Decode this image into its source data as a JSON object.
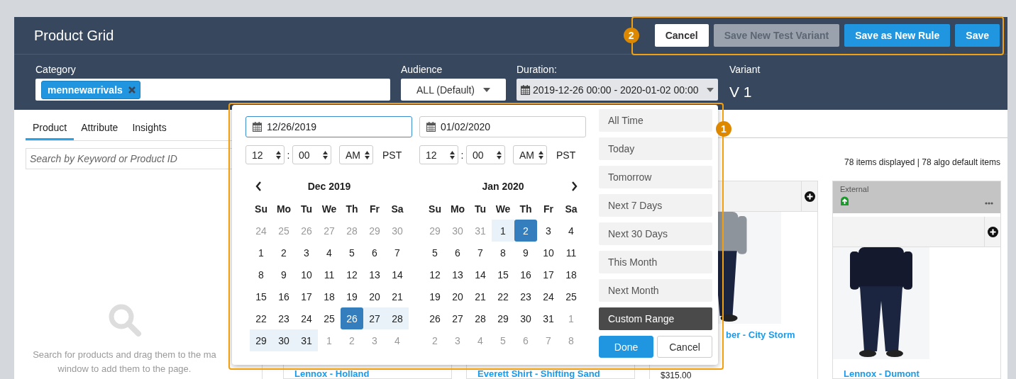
{
  "window": {
    "title": "Product Grid"
  },
  "header_buttons": [
    {
      "label": "Cancel",
      "kind": "default",
      "disabled": false
    },
    {
      "label": "Save New Test Variant",
      "kind": "default",
      "disabled": true
    },
    {
      "label": "Save as New Rule",
      "kind": "primary",
      "disabled": false
    },
    {
      "label": "Save",
      "kind": "primary",
      "disabled": false
    }
  ],
  "filters": {
    "category": {
      "label": "Category",
      "chips": [
        "mennewarrivals"
      ]
    },
    "audience": {
      "label": "Audience",
      "value": "ALL (Default)"
    },
    "duration": {
      "label": "Duration:",
      "value": "2019-12-26 00:00 - 2020-01-02 00:00"
    },
    "variant": {
      "label": "Variant",
      "value": "V 1"
    }
  },
  "left_panel": {
    "tabs": [
      {
        "label": "Product",
        "selected": true
      },
      {
        "label": "Attribute",
        "selected": false
      },
      {
        "label": "Insights",
        "selected": false
      }
    ],
    "search": {
      "placeholder": "Search by Keyword or Product ID"
    },
    "empty_text_lines": [
      "Search for products and drag them to the ma",
      "window to add them to the page."
    ]
  },
  "grid": {
    "count_text": "78 items displayed | 78 algo default items",
    "cards": [
      {
        "kind": "external",
        "name": "Lennox - Holland"
      },
      {
        "kind": "external",
        "name": "Everett Shirt - Shifting Sand"
      },
      {
        "kind": "plain",
        "name": "ber - City Storm",
        "price": "$315.00"
      },
      {
        "kind": "external",
        "tag": "External",
        "name": "Lennox - Dumont"
      }
    ]
  },
  "date_picker": {
    "inputs": [
      {
        "value": "12/26/2019",
        "focused": true
      },
      {
        "value": "01/02/2020",
        "focused": false
      }
    ],
    "times": [
      {
        "hour": "12",
        "separator": ":",
        "minute": "00",
        "ampm": "AM",
        "zone": "PST"
      },
      {
        "hour": "12",
        "separator": ":",
        "minute": "00",
        "ampm": "AM",
        "zone": "PST"
      }
    ],
    "calendars": [
      {
        "title": "Dec 2019",
        "weekdays": [
          "Su",
          "Mo",
          "Tu",
          "We",
          "Th",
          "Fr",
          "Sa"
        ],
        "weeks": [
          [
            {
              "day": "24",
              "outside": true,
              "in_range": false,
              "selected": false
            },
            {
              "day": "25",
              "outside": true,
              "in_range": false,
              "selected": false
            },
            {
              "day": "26",
              "outside": true,
              "in_range": false,
              "selected": false
            },
            {
              "day": "27",
              "outside": true,
              "in_range": false,
              "selected": false
            },
            {
              "day": "28",
              "outside": true,
              "in_range": false,
              "selected": false
            },
            {
              "day": "29",
              "outside": true,
              "in_range": false,
              "selected": false
            },
            {
              "day": "30",
              "outside": true,
              "in_range": false,
              "selected": false
            }
          ],
          [
            {
              "day": "1",
              "outside": false,
              "in_range": false,
              "selected": false
            },
            {
              "day": "2",
              "outside": false,
              "in_range": false,
              "selected": false
            },
            {
              "day": "3",
              "outside": false,
              "in_range": false,
              "selected": false
            },
            {
              "day": "4",
              "outside": false,
              "in_range": false,
              "selected": false
            },
            {
              "day": "5",
              "outside": false,
              "in_range": false,
              "selected": false
            },
            {
              "day": "6",
              "outside": false,
              "in_range": false,
              "selected": false
            },
            {
              "day": "7",
              "outside": false,
              "in_range": false,
              "selected": false
            }
          ],
          [
            {
              "day": "8",
              "outside": false,
              "in_range": false,
              "selected": false
            },
            {
              "day": "9",
              "outside": false,
              "in_range": false,
              "selected": false
            },
            {
              "day": "10",
              "outside": false,
              "in_range": false,
              "selected": false
            },
            {
              "day": "11",
              "outside": false,
              "in_range": false,
              "selected": false
            },
            {
              "day": "12",
              "outside": false,
              "in_range": false,
              "selected": false
            },
            {
              "day": "13",
              "outside": false,
              "in_range": false,
              "selected": false
            },
            {
              "day": "14",
              "outside": false,
              "in_range": false,
              "selected": false
            }
          ],
          [
            {
              "day": "15",
              "outside": false,
              "in_range": false,
              "selected": false
            },
            {
              "day": "16",
              "outside": false,
              "in_range": false,
              "selected": false
            },
            {
              "day": "17",
              "outside": false,
              "in_range": false,
              "selected": false
            },
            {
              "day": "18",
              "outside": false,
              "in_range": false,
              "selected": false
            },
            {
              "day": "19",
              "outside": false,
              "in_range": false,
              "selected": false
            },
            {
              "day": "20",
              "outside": false,
              "in_range": false,
              "selected": false
            },
            {
              "day": "21",
              "outside": false,
              "in_range": false,
              "selected": false
            }
          ],
          [
            {
              "day": "22",
              "outside": false,
              "in_range": false,
              "selected": false
            },
            {
              "day": "23",
              "outside": false,
              "in_range": false,
              "selected": false
            },
            {
              "day": "24",
              "outside": false,
              "in_range": false,
              "selected": false
            },
            {
              "day": "25",
              "outside": false,
              "in_range": false,
              "selected": false
            },
            {
              "day": "26",
              "outside": false,
              "in_range": true,
              "selected": true
            },
            {
              "day": "27",
              "outside": false,
              "in_range": true,
              "selected": false
            },
            {
              "day": "28",
              "outside": false,
              "in_range": true,
              "selected": false
            }
          ],
          [
            {
              "day": "29",
              "outside": false,
              "in_range": true,
              "selected": false
            },
            {
              "day": "30",
              "outside": false,
              "in_range": true,
              "selected": false
            },
            {
              "day": "31",
              "outside": false,
              "in_range": true,
              "selected": false
            },
            {
              "day": "1",
              "outside": true,
              "in_range": false,
              "selected": false
            },
            {
              "day": "2",
              "outside": true,
              "in_range": false,
              "selected": false
            },
            {
              "day": "3",
              "outside": true,
              "in_range": false,
              "selected": false
            },
            {
              "day": "4",
              "outside": true,
              "in_range": false,
              "selected": false
            }
          ]
        ]
      },
      {
        "title": "Jan 2020",
        "weekdays": [
          "Su",
          "Mo",
          "Tu",
          "We",
          "Th",
          "Fr",
          "Sa"
        ],
        "weeks": [
          [
            {
              "day": "29",
              "outside": true,
              "in_range": false,
              "selected": false
            },
            {
              "day": "30",
              "outside": true,
              "in_range": false,
              "selected": false
            },
            {
              "day": "31",
              "outside": true,
              "in_range": false,
              "selected": false
            },
            {
              "day": "1",
              "outside": false,
              "in_range": true,
              "selected": false
            },
            {
              "day": "2",
              "outside": false,
              "in_range": true,
              "selected": true
            },
            {
              "day": "3",
              "outside": false,
              "in_range": false,
              "selected": false
            },
            {
              "day": "4",
              "outside": false,
              "in_range": false,
              "selected": false
            }
          ],
          [
            {
              "day": "5",
              "outside": false,
              "in_range": false,
              "selected": false
            },
            {
              "day": "6",
              "outside": false,
              "in_range": false,
              "selected": false
            },
            {
              "day": "7",
              "outside": false,
              "in_range": false,
              "selected": false
            },
            {
              "day": "8",
              "outside": false,
              "in_range": false,
              "selected": false
            },
            {
              "day": "9",
              "outside": false,
              "in_range": false,
              "selected": false
            },
            {
              "day": "10",
              "outside": false,
              "in_range": false,
              "selected": false
            },
            {
              "day": "11",
              "outside": false,
              "in_range": false,
              "selected": false
            }
          ],
          [
            {
              "day": "12",
              "outside": false,
              "in_range": false,
              "selected": false
            },
            {
              "day": "13",
              "outside": false,
              "in_range": false,
              "selected": false
            },
            {
              "day": "14",
              "outside": false,
              "in_range": false,
              "selected": false
            },
            {
              "day": "15",
              "outside": false,
              "in_range": false,
              "selected": false
            },
            {
              "day": "16",
              "outside": false,
              "in_range": false,
              "selected": false
            },
            {
              "day": "17",
              "outside": false,
              "in_range": false,
              "selected": false
            },
            {
              "day": "18",
              "outside": false,
              "in_range": false,
              "selected": false
            }
          ],
          [
            {
              "day": "19",
              "outside": false,
              "in_range": false,
              "selected": false
            },
            {
              "day": "20",
              "outside": false,
              "in_range": false,
              "selected": false
            },
            {
              "day": "21",
              "outside": false,
              "in_range": false,
              "selected": false
            },
            {
              "day": "22",
              "outside": false,
              "in_range": false,
              "selected": false
            },
            {
              "day": "23",
              "outside": false,
              "in_range": false,
              "selected": false
            },
            {
              "day": "24",
              "outside": false,
              "in_range": false,
              "selected": false
            },
            {
              "day": "25",
              "outside": false,
              "in_range": false,
              "selected": false
            }
          ],
          [
            {
              "day": "26",
              "outside": false,
              "in_range": false,
              "selected": false
            },
            {
              "day": "27",
              "outside": false,
              "in_range": false,
              "selected": false
            },
            {
              "day": "28",
              "outside": false,
              "in_range": false,
              "selected": false
            },
            {
              "day": "29",
              "outside": false,
              "in_range": false,
              "selected": false
            },
            {
              "day": "30",
              "outside": false,
              "in_range": false,
              "selected": false
            },
            {
              "day": "31",
              "outside": false,
              "in_range": false,
              "selected": false
            },
            {
              "day": "1",
              "outside": true,
              "in_range": false,
              "selected": false
            }
          ],
          [
            {
              "day": "2",
              "outside": true,
              "in_range": false,
              "selected": false
            },
            {
              "day": "3",
              "outside": true,
              "in_range": false,
              "selected": false
            },
            {
              "day": "4",
              "outside": true,
              "in_range": false,
              "selected": false
            },
            {
              "day": "5",
              "outside": true,
              "in_range": false,
              "selected": false
            },
            {
              "day": "6",
              "outside": true,
              "in_range": false,
              "selected": false
            },
            {
              "day": "7",
              "outside": true,
              "in_range": false,
              "selected": false
            },
            {
              "day": "8",
              "outside": true,
              "in_range": false,
              "selected": false
            }
          ]
        ]
      }
    ],
    "ranges": [
      {
        "label": "All Time",
        "selected": false
      },
      {
        "label": "Today",
        "selected": false
      },
      {
        "label": "Tomorrow",
        "selected": false
      },
      {
        "label": "Next 7 Days",
        "selected": false
      },
      {
        "label": "Next 30 Days",
        "selected": false
      },
      {
        "label": "This Month",
        "selected": false
      },
      {
        "label": "Next Month",
        "selected": false
      },
      {
        "label": "Custom Range",
        "selected": true
      }
    ],
    "buttons": [
      {
        "label": "Done",
        "kind": "primary"
      },
      {
        "label": "Cancel",
        "kind": "default"
      }
    ]
  },
  "annotations": [
    {
      "label": "2",
      "kind": "toolbar"
    },
    {
      "label": "1",
      "kind": "popover"
    }
  ]
}
